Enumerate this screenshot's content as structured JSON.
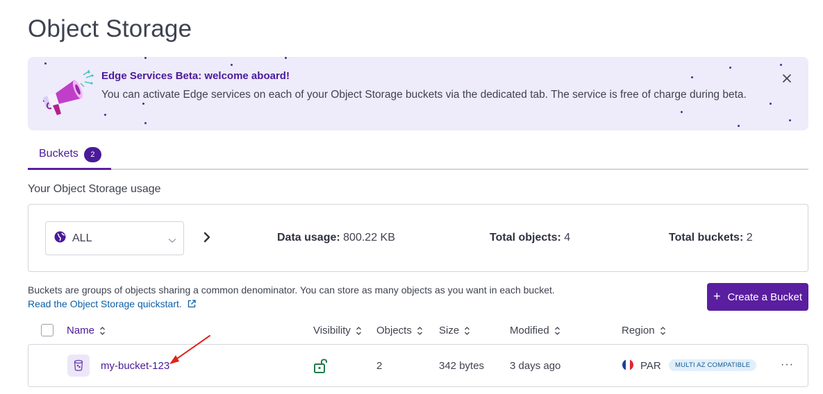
{
  "page": {
    "title": "Object Storage"
  },
  "banner": {
    "title": "Edge Services Beta: welcome aboard!",
    "text": "You can activate Edge services on each of your Object Storage buckets via the dedicated tab. The service is free of charge during beta.",
    "close_icon": "close-icon",
    "illustration_icon": "megaphone-icon"
  },
  "tabs": [
    {
      "label": "Buckets",
      "badge": "2",
      "active": true
    }
  ],
  "usage": {
    "title": "Your Object Storage usage",
    "region_select": {
      "value": "ALL",
      "icon": "globe-icon"
    },
    "next_icon": "chevron-right-icon",
    "stats": {
      "data_usage": {
        "label": "Data usage:",
        "value": "800.22 KB"
      },
      "total_objects": {
        "label": "Total objects:",
        "value": "4"
      },
      "total_buckets": {
        "label": "Total buckets:",
        "value": "2"
      }
    }
  },
  "info": {
    "description": "Buckets are groups of objects sharing a common denominator. You can store as many objects as you want in each bucket.",
    "quickstart_link": "Read the Object Storage quickstart.",
    "quickstart_icon": "external-link-icon"
  },
  "create_button": {
    "label": "Create a Bucket"
  },
  "table": {
    "columns": [
      "Name",
      "Visibility",
      "Objects",
      "Size",
      "Modified",
      "Region"
    ],
    "rows": [
      {
        "name": "my-bucket-123",
        "visibility_icon": "unlocked-padlock-icon",
        "objects": "2",
        "size": "342 bytes",
        "modified": "3 days ago",
        "region": "PAR",
        "region_badge": "MULTI AZ COMPATIBLE"
      }
    ]
  },
  "colors": {
    "primary": "#5a1ea0",
    "primary_text": "#4a1a9a",
    "banner_bg": "#eeebfa",
    "link": "#0a5fa8",
    "badge_bg": "#e1effb",
    "public_icon": "#1f7a4d",
    "annotation_arrow": "#e0241b"
  }
}
